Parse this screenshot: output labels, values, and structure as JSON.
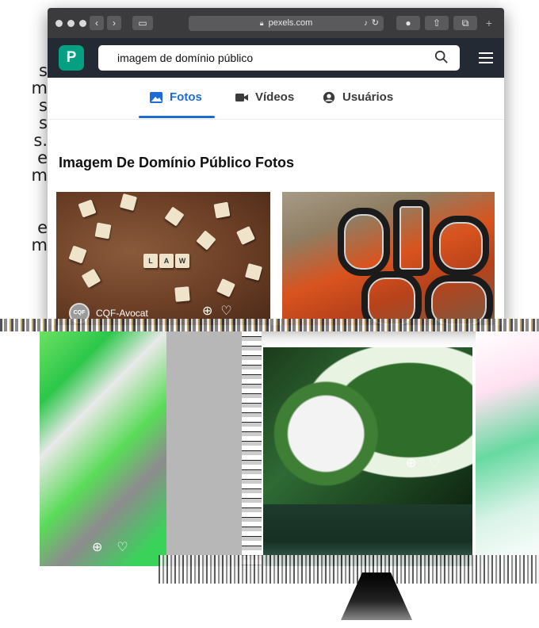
{
  "side_text": [
    "s",
    "m",
    "s",
    "s",
    "s.",
    "e",
    "m",
    "",
    "",
    "e",
    "m"
  ],
  "browser": {
    "url": "pexels.com"
  },
  "pexels": {
    "logo_letter": "P",
    "search_value": "imagem de domínio público",
    "tabs": [
      {
        "label": "Fotos",
        "active": true,
        "icon": "image-icon"
      },
      {
        "label": "Vídeos",
        "active": false,
        "icon": "video-camera-icon"
      },
      {
        "label": "Usuários",
        "active": false,
        "icon": "user-circle-icon"
      }
    ],
    "heading": "Imagem De Domínio Público Fotos",
    "photos": [
      {
        "author": "CQF-Avocat",
        "tiles": [
          "L",
          "A",
          "W"
        ]
      }
    ]
  },
  "colors": {
    "pexels_green": "#05a081",
    "header_dark": "#232a34",
    "active_tab": "#1e6bd8",
    "safari_toolbar": "#3b3b3d"
  }
}
